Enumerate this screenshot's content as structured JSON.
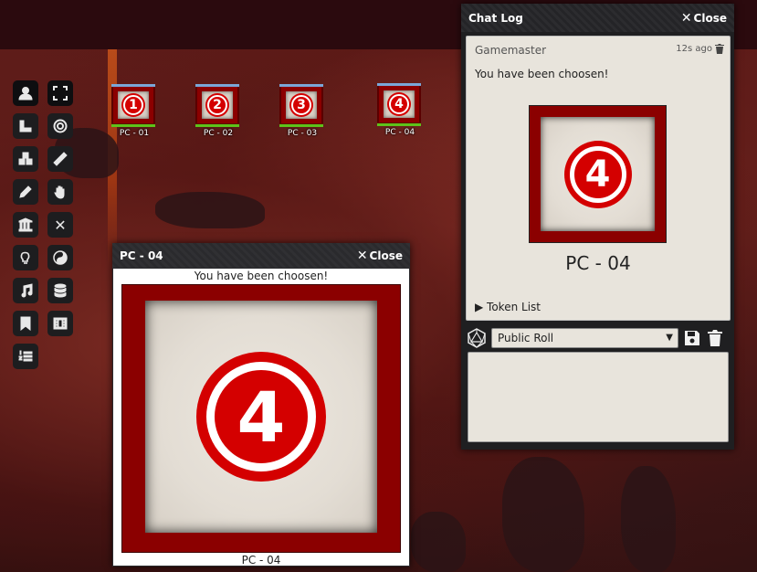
{
  "tokens": [
    {
      "number": "1",
      "label": "PC - 01"
    },
    {
      "number": "2",
      "label": "PC - 02"
    },
    {
      "number": "3",
      "label": "PC - 03"
    },
    {
      "number": "4",
      "label": "PC - 04"
    }
  ],
  "popout": {
    "title": "PC - 04",
    "close_label": "Close",
    "caption_top": "You have been choosen!",
    "number": "4",
    "caption_bottom": "PC - 04"
  },
  "chat": {
    "title": "Chat Log",
    "close_label": "Close",
    "sender": "Gamemaster",
    "time": "12s ago",
    "message": "You have been choosen!",
    "number": "4",
    "card_caption": "PC - 04",
    "token_list": "Token List",
    "roll_mode": "Public Roll"
  },
  "colors": {
    "token_frame": "#8b0000",
    "badge": "#d40000",
    "hp_bar": "#5ec21a",
    "top_bar": "#7aa7d8"
  }
}
